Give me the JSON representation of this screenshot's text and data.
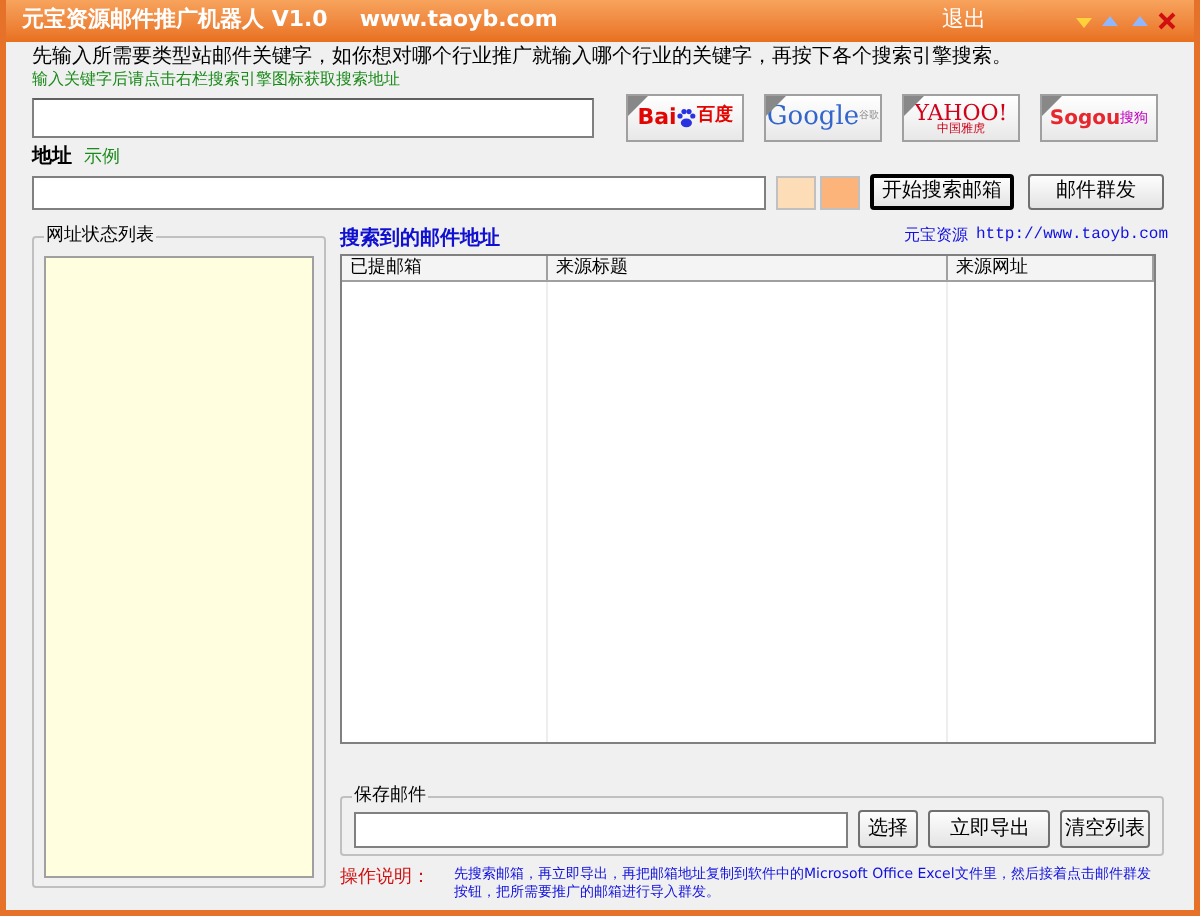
{
  "window": {
    "title": "元宝资源邮件推广机器人 V1.0",
    "url": "www.taoyb.com",
    "exit": "退出"
  },
  "intro": "先输入所需要类型站邮件关键字，如你想对哪个行业推广就输入哪个行业的关键字，再按下各个搜索引擎搜索。",
  "hint": "输入关键字后请点击右栏搜索引擎图标获取搜索地址",
  "engines": [
    {
      "kind": "baidu",
      "parts": [
        "Bai",
        "百度"
      ]
    },
    {
      "kind": "google",
      "parts": [
        "Google",
        "谷歌"
      ]
    },
    {
      "kind": "yahoo",
      "parts": [
        "YAHOO!",
        "中国雅虎"
      ]
    },
    {
      "kind": "sogou",
      "parts": [
        "Sogou",
        "搜狗"
      ]
    }
  ],
  "address": {
    "label": "地址",
    "example": "示例"
  },
  "swatches": [
    {
      "color": "#fddcb8"
    },
    {
      "color": "#fcb47a"
    }
  ],
  "buttons": [
    "开始搜索邮箱",
    "邮件群发"
  ],
  "status_list": {
    "title": "网址状态列表"
  },
  "results": {
    "title": "搜索到的邮件地址",
    "credit": "元宝资源",
    "credit_url": "http://www.taoyb.com",
    "columns": [
      "已提邮箱",
      "来源标题",
      "来源网址"
    ]
  },
  "save": {
    "title": "保存邮件",
    "buttons": [
      "选择",
      "立即导出",
      "清空列表"
    ]
  },
  "instructions": {
    "label": "操作说明：",
    "text": "先搜索邮箱，再立即导出，再把邮箱地址复制到软件中的Microsoft Office Excel文件里，然后接着点击邮件群发按钮，把所需要推广的邮箱进行导入群发。"
  }
}
